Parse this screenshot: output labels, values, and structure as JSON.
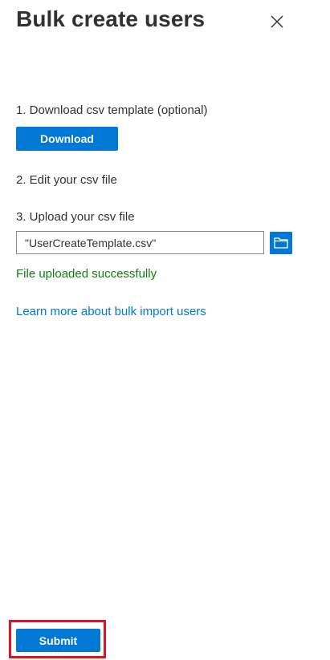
{
  "panel": {
    "title": "Bulk create users",
    "close_icon": "close-icon"
  },
  "steps": {
    "step1_label": "1. Download csv template (optional)",
    "download_label": "Download",
    "step2_label": "2. Edit your csv file",
    "step3_label": "3. Upload your csv file",
    "file_value": "\"UserCreateTemplate.csv\"",
    "folder_icon": "folder-icon"
  },
  "status": {
    "success_text": "File uploaded successfully"
  },
  "links": {
    "learn_more": "Learn more about bulk import users"
  },
  "footer": {
    "submit_label": "Submit"
  },
  "colors": {
    "accent": "#0078d4",
    "success": "#107c10",
    "highlight": "#e81123",
    "text": "#323130"
  }
}
